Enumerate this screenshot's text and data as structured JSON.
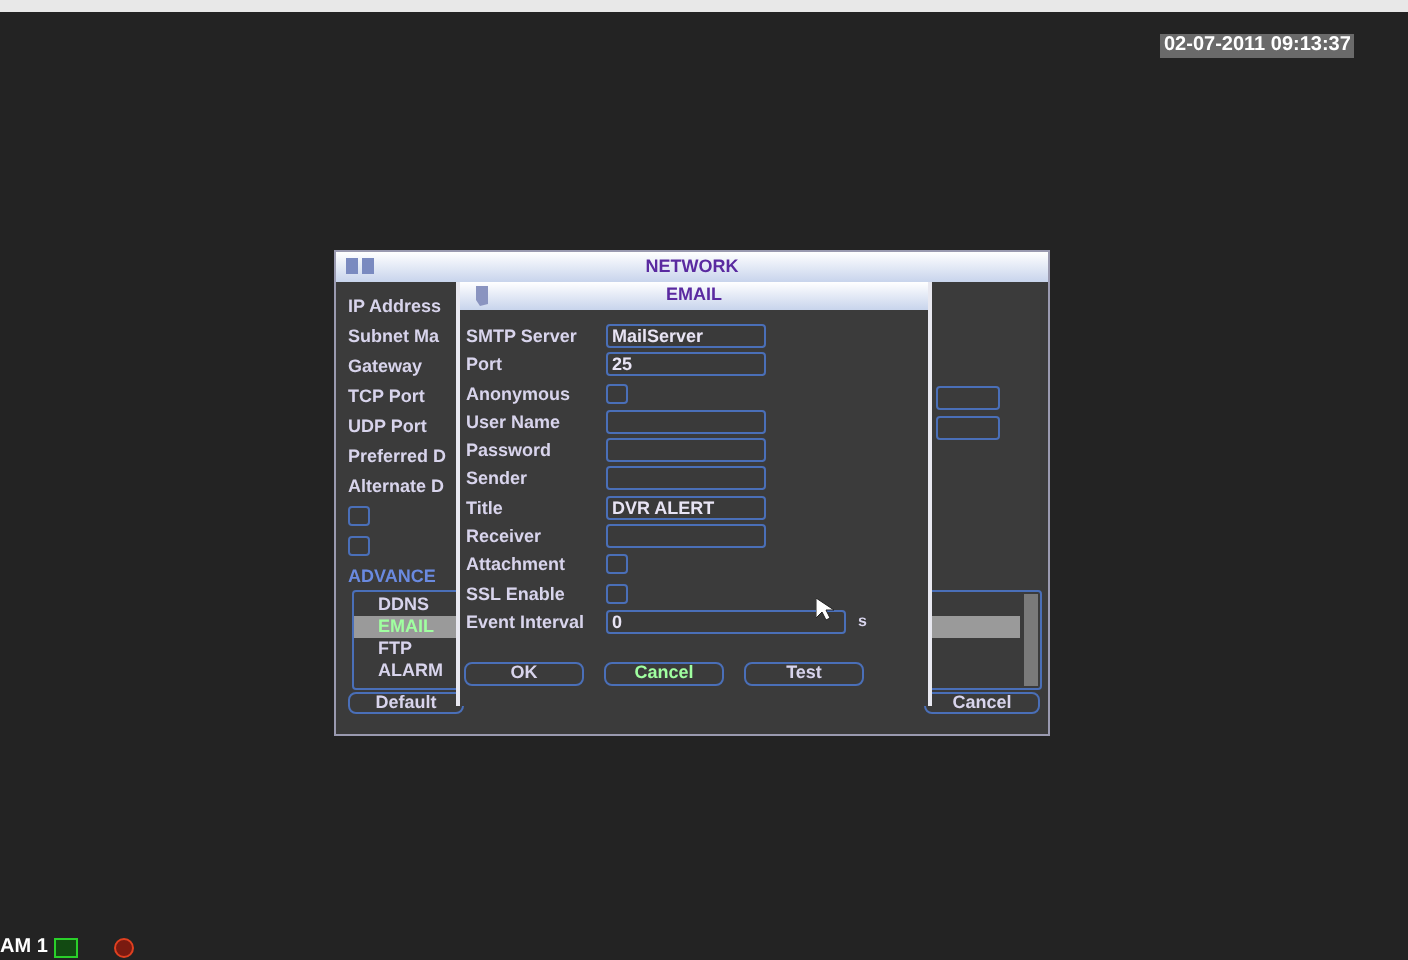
{
  "overlay": {
    "timestamp": "02-07-2011 09:13:37",
    "channel_label": "AM 1"
  },
  "network": {
    "title": "NETWORK",
    "labels": [
      "IP Address",
      "Subnet Ma",
      "Gateway",
      "TCP Port",
      "UDP Port",
      "Preferred D",
      "Alternate D"
    ],
    "checkboxes": [
      {
        "checked": false
      },
      {
        "checked": false
      }
    ],
    "section": "ADVANCE",
    "list": [
      {
        "label": "DDNS",
        "selected": false
      },
      {
        "label": "EMAIL",
        "selected": true
      },
      {
        "label": "FTP",
        "selected": false
      },
      {
        "label": "ALARM",
        "selected": false
      }
    ],
    "buttons": [
      "Default",
      "Cancel"
    ]
  },
  "email": {
    "title": "EMAIL",
    "rows": [
      {
        "kind": "text",
        "label": "SMTP Server",
        "value": "MailServer"
      },
      {
        "kind": "text",
        "label": "Port",
        "value": "25"
      },
      {
        "kind": "checkbox",
        "label": "Anonymous",
        "checked": false
      },
      {
        "kind": "text",
        "label": "User Name",
        "value": ""
      },
      {
        "kind": "text",
        "label": "Password",
        "value": ""
      },
      {
        "kind": "text",
        "label": "Sender",
        "value": ""
      },
      {
        "kind": "text",
        "label": "Title",
        "value": "DVR ALERT"
      },
      {
        "kind": "text",
        "label": "Receiver",
        "value": ""
      },
      {
        "kind": "checkbox",
        "label": "Attachment",
        "checked": false
      },
      {
        "kind": "checkbox",
        "label": "SSL Enable",
        "checked": false
      },
      {
        "kind": "interval",
        "label": "Event Interval",
        "value": "0",
        "unit": "s"
      }
    ],
    "buttons": [
      "OK",
      "Cancel",
      "Test"
    ]
  }
}
